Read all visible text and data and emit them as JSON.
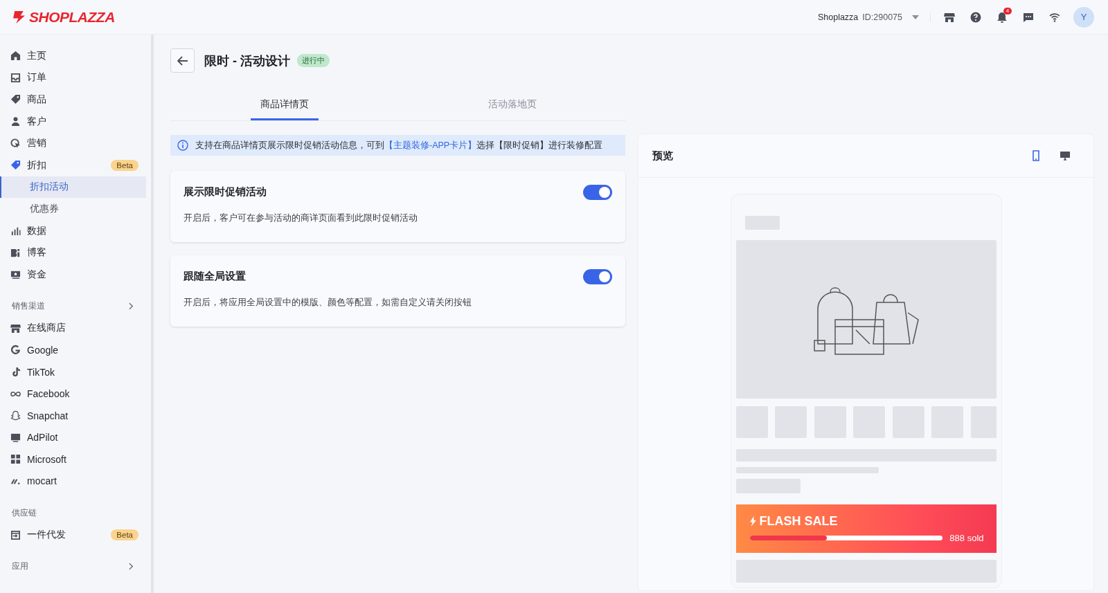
{
  "header": {
    "logo": "SHOPLAZZA",
    "store_name": "Shoplazza",
    "store_id": "ID:290075",
    "notification_count": "4",
    "avatar": "Y"
  },
  "sidebar": {
    "groups": [
      {
        "items": [
          {
            "label": "主页",
            "selected": false
          },
          {
            "label": "订单",
            "selected": false
          },
          {
            "label": "商品",
            "selected": false
          },
          {
            "label": "客户",
            "selected": false
          },
          {
            "label": "营销",
            "selected": false
          },
          {
            "label": "折扣",
            "badge": "Beta",
            "selected": false,
            "expanded": true,
            "children": [
              {
                "label": "折扣活动",
                "selected": true
              },
              {
                "label": "优惠券",
                "selected": false
              }
            ]
          },
          {
            "label": "数据",
            "selected": false
          },
          {
            "label": "博客",
            "selected": false
          },
          {
            "label": "资金",
            "selected": false
          }
        ]
      },
      {
        "heading": "销售渠道",
        "expandable": true,
        "items": [
          {
            "label": "在线商店",
            "selected": false
          },
          {
            "label": "Google",
            "selected": false
          },
          {
            "label": "TikTok",
            "selected": false
          },
          {
            "label": "Facebook",
            "selected": false
          },
          {
            "label": "Snapchat",
            "selected": false
          },
          {
            "label": "AdPilot",
            "selected": false
          },
          {
            "label": "Microsoft",
            "selected": false
          },
          {
            "label": "mocart",
            "selected": false
          }
        ]
      },
      {
        "heading": "供应链",
        "expandable": false,
        "items": [
          {
            "label": "一件代发",
            "badge": "Beta",
            "selected": false
          }
        ]
      },
      {
        "heading": "应用",
        "expandable": true
      }
    ]
  },
  "page": {
    "title": "限时 - 活动设计",
    "status": "进行中",
    "tabs": [
      {
        "label": "商品详情页",
        "selected": true
      },
      {
        "label": "活动落地页",
        "selected": false
      }
    ],
    "info": {
      "text_before": "支持在商品详情页展示限时促销活动信息，可到",
      "link": "【主题装修-APP卡片】",
      "text_after": "选择【限时促销】进行装修配置"
    },
    "settings": [
      {
        "title": "展示限时促销活动",
        "description": "开启后，客户可在参与活动的商详页面看到此限时促销活动",
        "on": true
      },
      {
        "title": "跟随全局设置",
        "description": "开启后，将应用全局设置中的模版、颜色等配置，如需自定义请关闭按钮",
        "on": true
      }
    ]
  },
  "preview": {
    "title": "预览",
    "devices": [
      {
        "kind": "mobile",
        "selected": true
      },
      {
        "kind": "desktop",
        "selected": false
      }
    ],
    "flash_sale": {
      "title": "FLASH SALE",
      "level": 0.4,
      "reading": "888 sold"
    }
  }
}
